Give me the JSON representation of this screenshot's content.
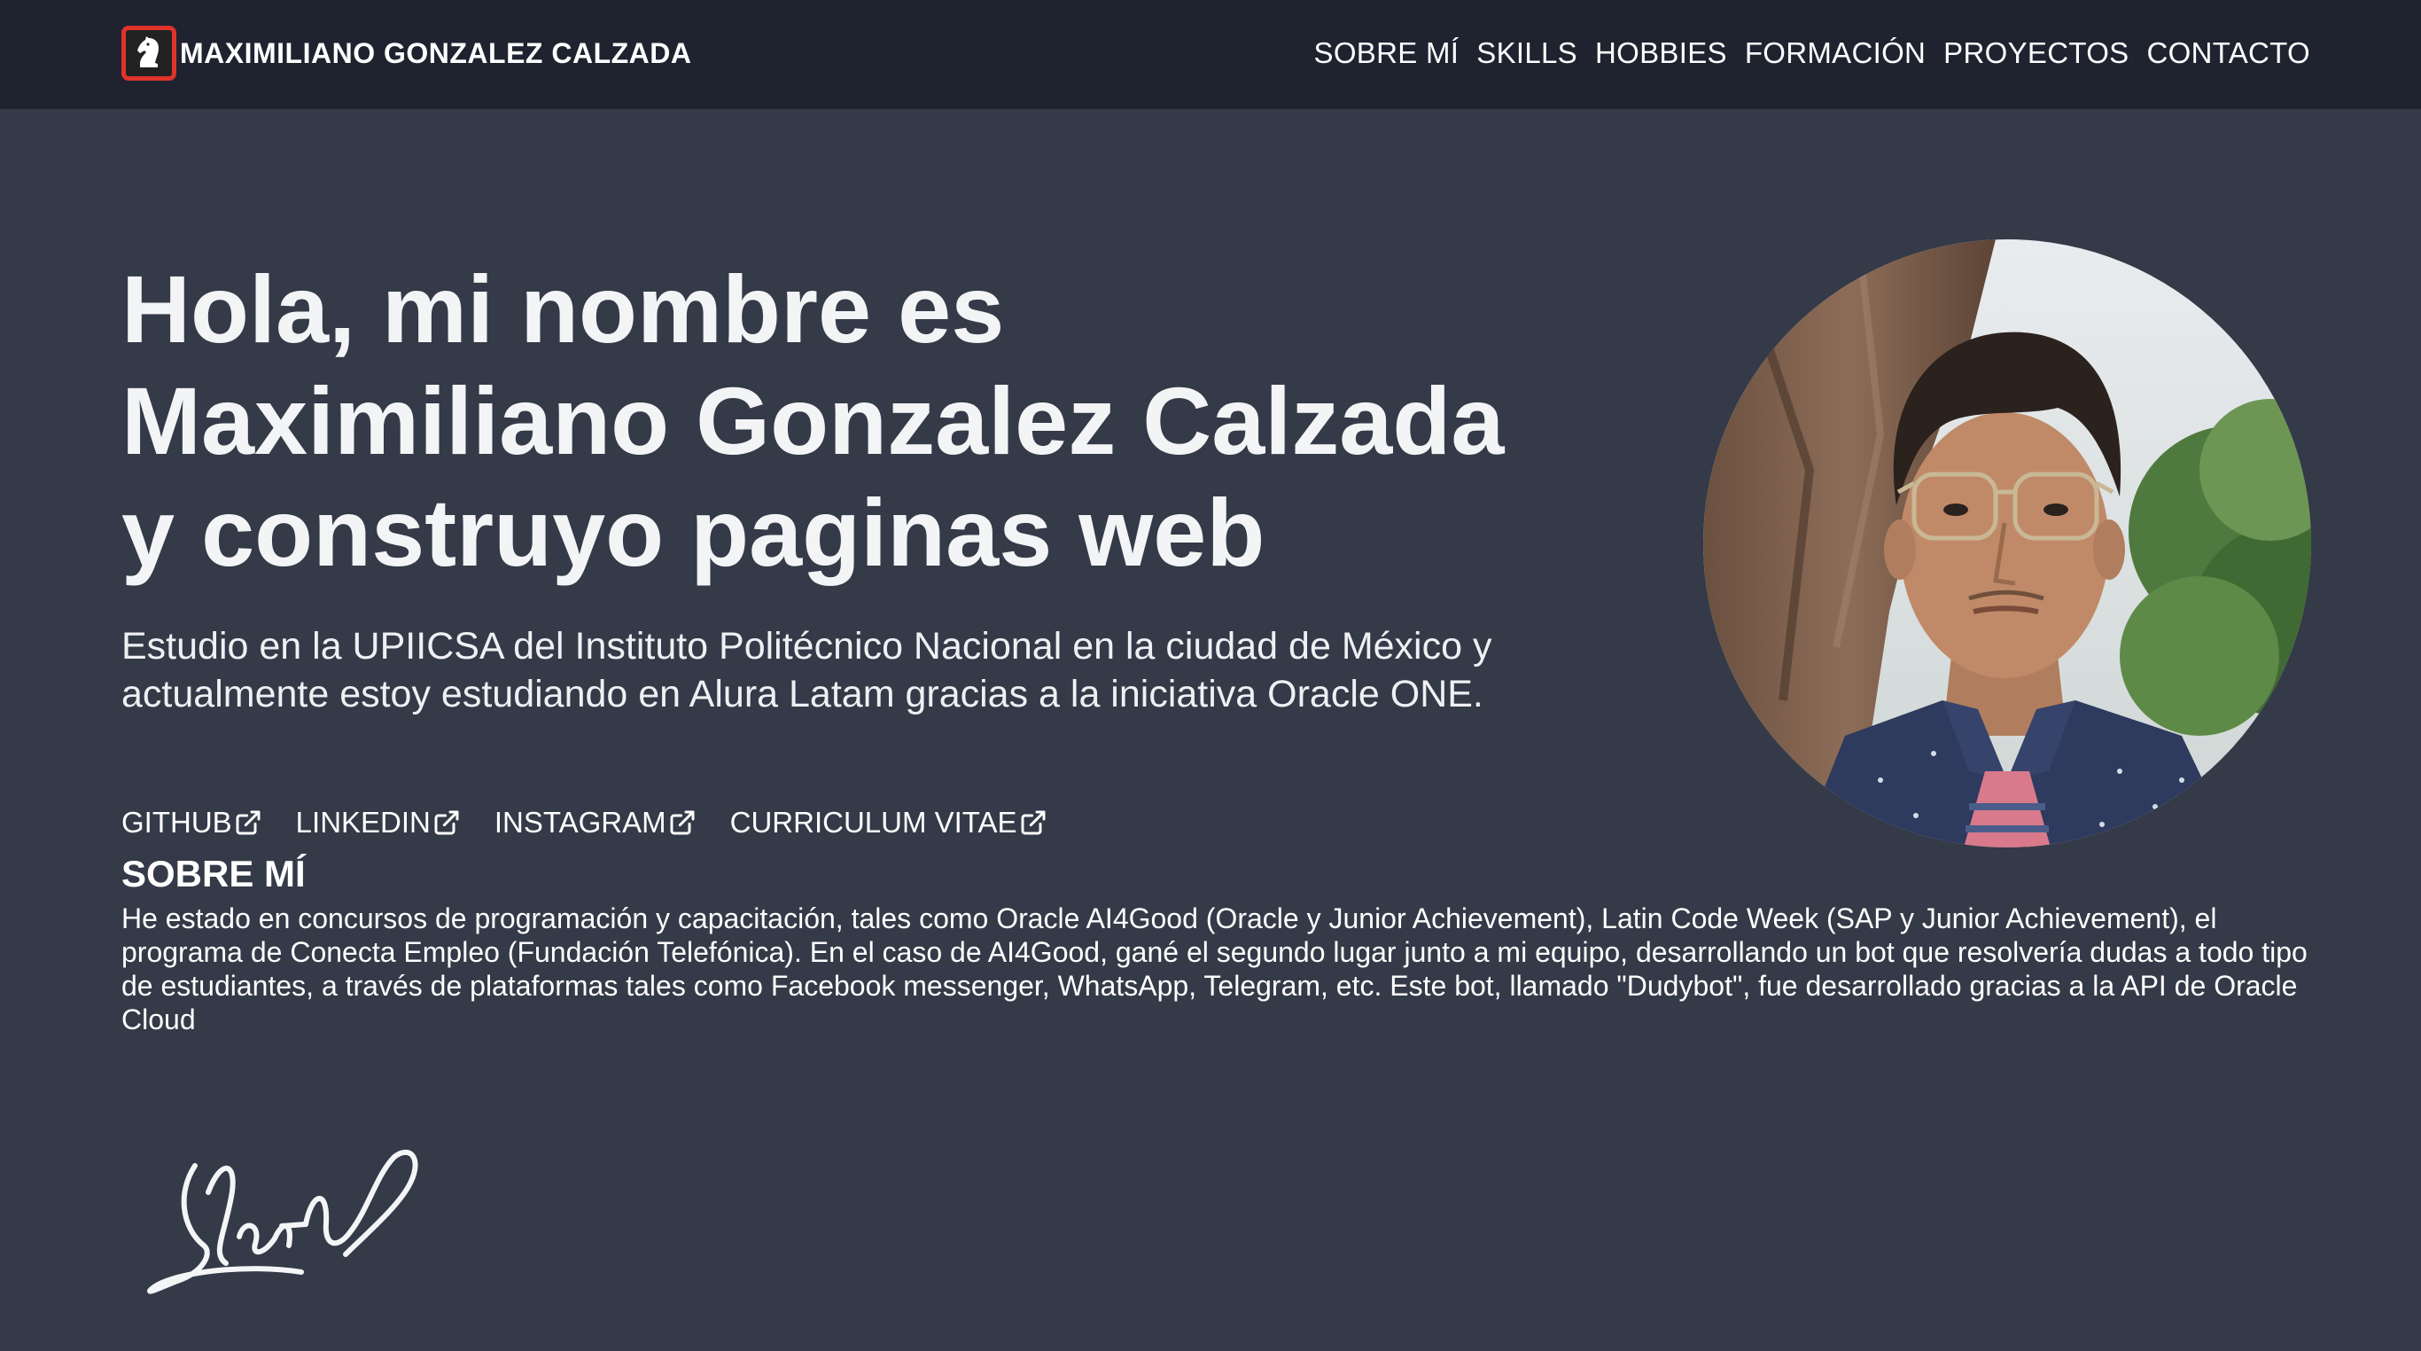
{
  "header": {
    "brand_name": "MAXIMILIANO GONZALEZ CALZADA",
    "logo_icon": "chess-knight-icon",
    "nav": [
      {
        "label": "SOBRE MÍ"
      },
      {
        "label": "SKILLS"
      },
      {
        "label": "HOBBIES"
      },
      {
        "label": "FORMACIÓN"
      },
      {
        "label": "PROYECTOS"
      },
      {
        "label": "CONTACTO"
      }
    ]
  },
  "hero": {
    "title_lines": [
      "Hola, mi nombre es",
      "Maximiliano Gonzalez Calzada",
      "y construyo paginas web"
    ],
    "subtitle": "Estudio en la UPIICSA del Instituto Politécnico Nacional en la ciudad de México y actualmente estoy estudiando en Alura Latam gracias a la iniciativa Oracle ONE.",
    "links": [
      {
        "label": "GITHUB",
        "icon": "external-link-icon"
      },
      {
        "label": "LINKEDIN",
        "icon": "external-link-icon"
      },
      {
        "label": "INSTAGRAM",
        "icon": "external-link-icon"
      },
      {
        "label": "CURRICULUM VITAE",
        "icon": "external-link-icon"
      }
    ]
  },
  "about": {
    "heading": "SOBRE MÍ",
    "text": "He estado en concursos de programación y capacitación, tales como Oracle AI4Good (Oracle y Junior Achievement), Latin Code Week (SAP y Junior Achievement), el programa de Conecta Empleo (Fundación Telefónica). En el caso de AI4Good, gané el segundo lugar junto a mi equipo, desarrollando un bot que resolvería dudas a todo tipo de estudiantes, a través de plataformas tales como Facebook messenger, WhatsApp, Telegram, etc. Este bot, llamado \"Dudybot\", fue desarrollado gracias a la API de Oracle Cloud"
  },
  "colors": {
    "page_background": "#343a47",
    "header_background": "#1f2330",
    "logo_border": "#e0332b",
    "text": "#f3f4f6"
  }
}
